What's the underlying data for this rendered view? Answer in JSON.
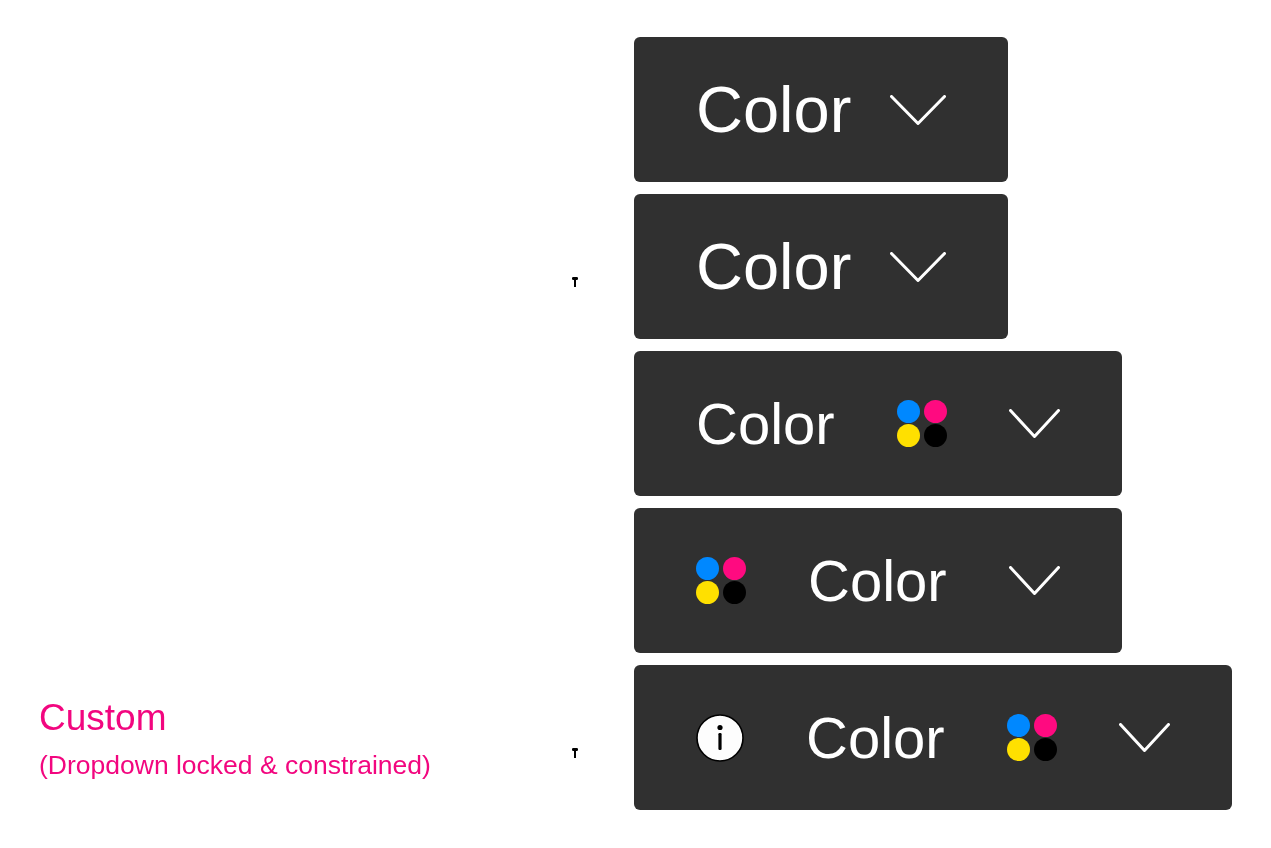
{
  "dropdowns": [
    {
      "parts": [
        {
          "kind": "label",
          "text": "Color"
        },
        {
          "kind": "chevron"
        }
      ],
      "pinned": false
    },
    {
      "parts": [
        {
          "kind": "label",
          "text": "Color"
        },
        {
          "kind": "chevron"
        }
      ],
      "pinned": true
    },
    {
      "parts": [
        {
          "kind": "label",
          "text": "Color"
        },
        {
          "kind": "swatch"
        },
        {
          "kind": "chevron"
        }
      ],
      "pinned": false
    },
    {
      "parts": [
        {
          "kind": "swatch"
        },
        {
          "kind": "label",
          "text": "Color"
        },
        {
          "kind": "chevron"
        }
      ],
      "pinned": false
    },
    {
      "parts": [
        {
          "kind": "info"
        },
        {
          "kind": "label",
          "text": "Color"
        },
        {
          "kind": "swatch"
        },
        {
          "kind": "chevron"
        }
      ],
      "pinned": true,
      "note": {
        "title": "Custom",
        "subtitle": "(Dropdown locked & constrained)"
      }
    }
  ]
}
